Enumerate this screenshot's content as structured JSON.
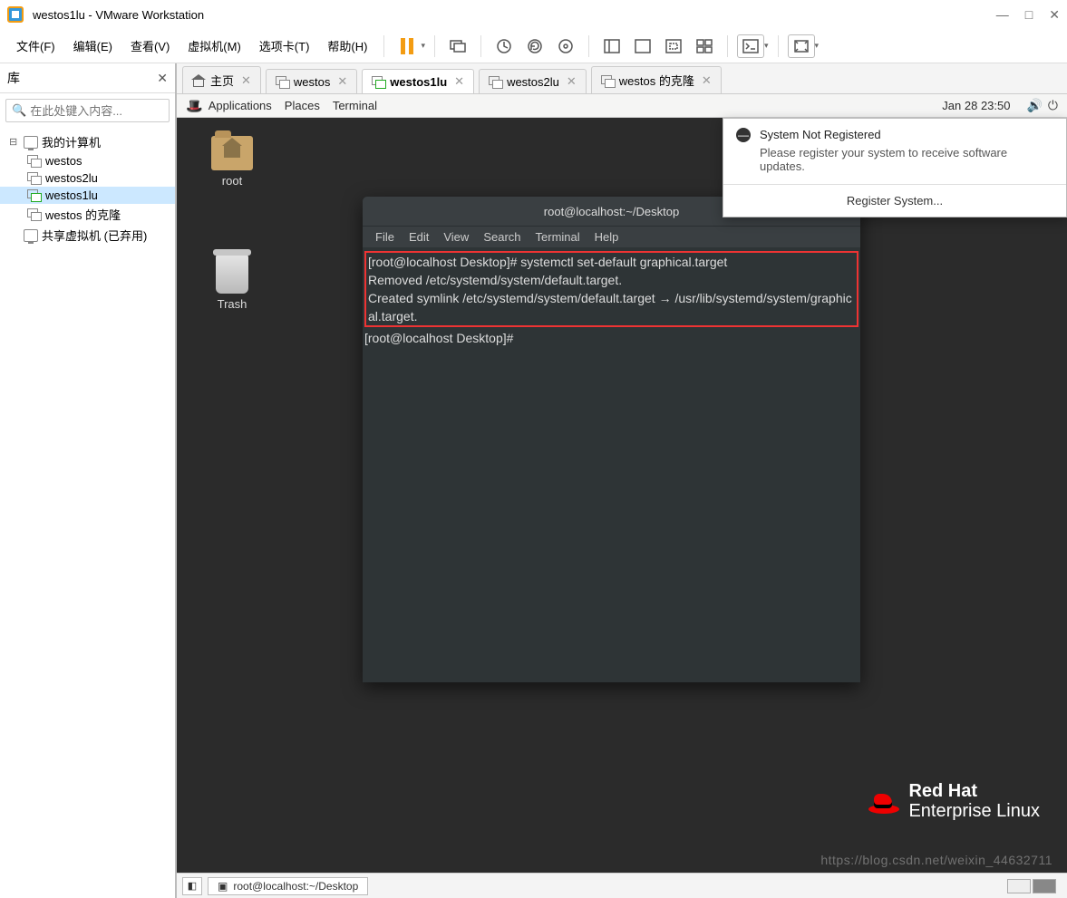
{
  "window": {
    "title": "westos1lu - VMware Workstation"
  },
  "menubar": {
    "items": [
      "文件(F)",
      "编辑(E)",
      "查看(V)",
      "虚拟机(M)",
      "选项卡(T)",
      "帮助(H)"
    ]
  },
  "sidebar": {
    "title": "库",
    "search_placeholder": "在此处键入内容...",
    "nodes": {
      "root": "我的计算机",
      "children": [
        "westos",
        "westos2lu",
        "westos1lu",
        "westos 的克隆"
      ],
      "shared": "共享虚拟机 (已弃用)"
    },
    "selected": "westos1lu"
  },
  "tabs": [
    {
      "label": "主页",
      "type": "home",
      "active": false
    },
    {
      "label": "westos",
      "type": "vm",
      "active": false
    },
    {
      "label": "westos1lu",
      "type": "vm-on",
      "active": true
    },
    {
      "label": "westos2lu",
      "type": "vm",
      "active": false
    },
    {
      "label": "westos 的克隆",
      "type": "vm",
      "active": false
    }
  ],
  "gnome": {
    "menus": [
      "Applications",
      "Places",
      "Terminal"
    ],
    "clock": "Jan 28  23:50"
  },
  "desktop_icons": {
    "root": "root",
    "trash": "Trash"
  },
  "terminal": {
    "title": "root@localhost:~/Desktop",
    "menus": [
      "File",
      "Edit",
      "View",
      "Search",
      "Terminal",
      "Help"
    ],
    "highlighted": "[root@localhost Desktop]# systemctl set-default graphical.target\nRemoved /etc/systemd/system/default.target.\nCreated symlink /etc/systemd/system/default.target → /usr/lib/systemd/system/graphical.target.",
    "after": "[root@localhost Desktop]# "
  },
  "notification": {
    "title": "System Not Registered",
    "body": "Please register your system to receive software updates.",
    "button": "Register System..."
  },
  "rh_logo": {
    "line1": "Red Hat",
    "line2": "Enterprise Linux"
  },
  "statusbar": {
    "task": "root@localhost:~/Desktop"
  },
  "watermark": "https://blog.csdn.net/weixin_44632711"
}
